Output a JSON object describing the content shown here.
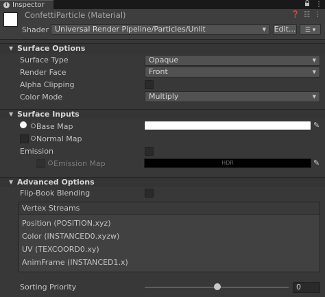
{
  "tab": {
    "label": "Inspector",
    "icon": "info-icon"
  },
  "header": {
    "title": "ConfettiParticle (Material)",
    "shader_label": "Shader",
    "shader_value": "Universal Render Pipeline/Particles/Unlit",
    "edit_label": "Edit...",
    "icons": [
      "help-icon",
      "presets-icon",
      "more-icon"
    ]
  },
  "surface_options": {
    "title": "Surface Options",
    "surface_type": {
      "label": "Surface Type",
      "value": "Opaque"
    },
    "render_face": {
      "label": "Render Face",
      "value": "Front"
    },
    "alpha_clipping": {
      "label": "Alpha Clipping",
      "checked": false
    },
    "color_mode": {
      "label": "Color Mode",
      "value": "Multiply"
    }
  },
  "surface_inputs": {
    "title": "Surface Inputs",
    "base_map": {
      "label": "Base Map",
      "color": "#ffffff"
    },
    "normal_map": {
      "label": "Normal Map"
    },
    "emission": {
      "label": "Emission",
      "checked": false
    },
    "emission_map": {
      "label": "Emission Map",
      "hdr_text": "HDR",
      "color": "#000000"
    }
  },
  "advanced_options": {
    "title": "Advanced Options",
    "flip_book": {
      "label": "Flip-Book Blending",
      "checked": false
    },
    "vertex_streams": {
      "title": "Vertex Streams",
      "items": [
        "Position (POSITION.xyz)",
        "Color (INSTANCED0.xyzw)",
        "UV (TEXCOORD0.xy)",
        "AnimFrame (INSTANCED1.x)"
      ]
    },
    "sorting_priority": {
      "label": "Sorting Priority",
      "value": "0"
    }
  }
}
